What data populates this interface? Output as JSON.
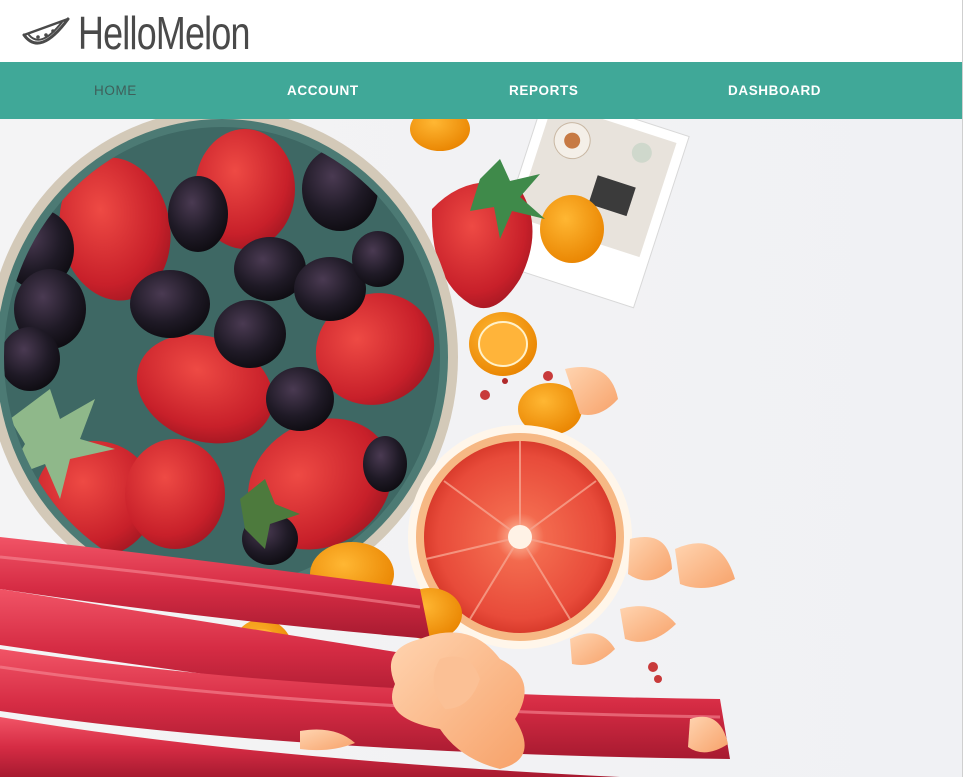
{
  "brand": {
    "name": "HelloMelon",
    "logo_icon": "watermelon-slice-icon",
    "text_color": "#4a4a4a"
  },
  "nav": {
    "background": "#40a898",
    "items": [
      {
        "label": "HOME",
        "active": true
      },
      {
        "label": "ACCOUNT",
        "active": false
      },
      {
        "label": "REPORTS",
        "active": false
      },
      {
        "label": "DASHBOARD",
        "active": false
      }
    ]
  },
  "hero": {
    "image": "fruit-bowl-hero-image"
  }
}
